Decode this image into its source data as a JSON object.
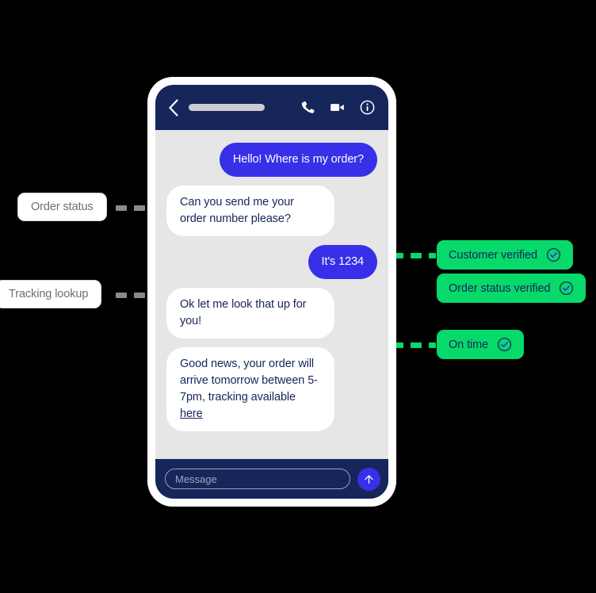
{
  "phone": {
    "header": {
      "back_icon": "chevron-left-icon",
      "contact_name_placeholder_bar": "",
      "call_icon": "phone-icon",
      "video_icon": "video-camera-icon",
      "info_icon": "info-circle-icon"
    },
    "messages": [
      {
        "id": "m1",
        "direction": "out",
        "text": "Hello! Where is my order?"
      },
      {
        "id": "m2",
        "direction": "in",
        "text": "Can you send me your order number please?"
      },
      {
        "id": "m3",
        "direction": "out",
        "text": "It's 1234"
      },
      {
        "id": "m4",
        "direction": "in",
        "text": "Ok let me look that up for you!"
      },
      {
        "id": "m5",
        "direction": "in",
        "text": "Good news, your order will arrive tomorrow between 5-7pm, tracking available ",
        "link_text": "here"
      }
    ],
    "composer": {
      "placeholder": "Message",
      "value": "",
      "send_icon": "arrow-up-icon"
    }
  },
  "annotations": {
    "left_labels": [
      {
        "id": "order-status",
        "text": "Order status"
      },
      {
        "id": "tracking-lookup",
        "text": "Tracking lookup"
      }
    ],
    "right_badges": [
      {
        "id": "customer-verified",
        "text": "Customer verified",
        "icon": "check-circle-icon"
      },
      {
        "id": "order-status-verified",
        "text": "Order status verified",
        "icon": "check-circle-icon"
      },
      {
        "id": "on-time",
        "text": "On time",
        "icon": "check-circle-icon"
      }
    ]
  },
  "colors": {
    "background": "#000000",
    "phone_frame": "#ffffff",
    "header_navy": "#16265a",
    "chat_background": "#e6e6e6",
    "bubble_outgoing": "#3730e8",
    "bubble_incoming": "#ffffff",
    "badge_green": "#07d96a",
    "label_grey_text": "#6e6e6e",
    "connector_grey": "#8a8a8a",
    "check_blue": "#3730e8"
  }
}
